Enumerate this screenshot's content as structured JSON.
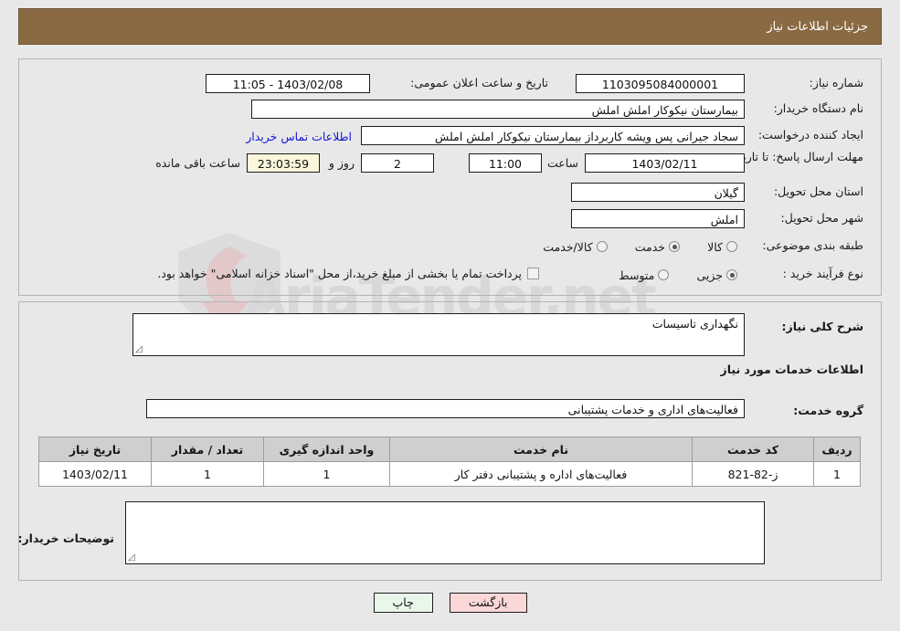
{
  "header": {
    "title": "جزئیات اطلاعات نیاز"
  },
  "top": {
    "need_number_label": "شماره نیاز:",
    "need_number_value": "1103095084000001",
    "announce_label": "تاریخ و ساعت اعلان عمومی:",
    "announce_value": "1403/02/08 - 11:05",
    "buyer_org_label": "نام دستگاه خریدار:",
    "buyer_org_value": "بیمارستان نیکوکار املش املش",
    "creator_label": "ایجاد کننده درخواست:",
    "creator_value": "سجاد جیرانی پس ویشه کاربرداز بیمارستان نیکوکار املش املش",
    "contact_link": "اطلاعات تماس خریدار",
    "deadline_label": "مهلت ارسال پاسخ: تا تاریخ:",
    "deadline_date": "1403/02/11",
    "deadline_hour_label": "ساعت",
    "deadline_hour": "11:00",
    "remaining_days": "2",
    "remaining_days_label": "روز و",
    "remaining_time": "23:03:59",
    "remaining_time_label": "ساعت باقی مانده",
    "province_label": "استان محل تحویل:",
    "province_value": "گیلان",
    "city_label": "شهر محل تحویل:",
    "city_value": "املش",
    "category_label": "طبقه بندی موضوعی:",
    "category_options": [
      {
        "label": "کالا",
        "selected": false
      },
      {
        "label": "خدمت",
        "selected": true
      },
      {
        "label": "کالا/خدمت",
        "selected": false
      }
    ],
    "process_label": "نوع فرآیند خرید :",
    "process_options": [
      {
        "label": "جزیی",
        "selected": true
      },
      {
        "label": "متوسط",
        "selected": false
      }
    ],
    "payment_note": "پرداخت تمام یا بخشی از مبلغ خرید،از محل \"اسناد خزانه اسلامی\" خواهد بود."
  },
  "mid": {
    "general_desc_label": "شرح کلی نیاز:",
    "general_desc_value": "نگهداری تاسیسات",
    "services_section_title": "اطلاعات خدمات مورد نیاز",
    "service_group_label": "گروه خدمت:",
    "service_group_value": "فعالیت‌های اداری و خدمات پشتیبانی",
    "buyer_notes_label": "توضیحات خریدار:",
    "buyer_notes_value": ""
  },
  "table": {
    "columns": [
      "ردیف",
      "کد خدمت",
      "نام خدمت",
      "واحد اندازه گیری",
      "تعداد / مقدار",
      "تاریخ نیاز"
    ],
    "rows": [
      {
        "radif": "1",
        "code": "ز-82-821",
        "name": "فعالیت‌های اداره و پشتیبانی دفتر کار",
        "unit": "1",
        "qty": "1",
        "date": "1403/02/11"
      }
    ]
  },
  "footer": {
    "print_label": "چاپ",
    "back_label": "بازگشت"
  },
  "watermark": {
    "text": "AriaTender.net"
  },
  "colors": {
    "header_bg": "#8a6a42",
    "link": "#1414d8",
    "print_btn": "#e9f7ea",
    "back_btn": "#fbd8d8",
    "countdown_bg": "#fbf7dc"
  }
}
